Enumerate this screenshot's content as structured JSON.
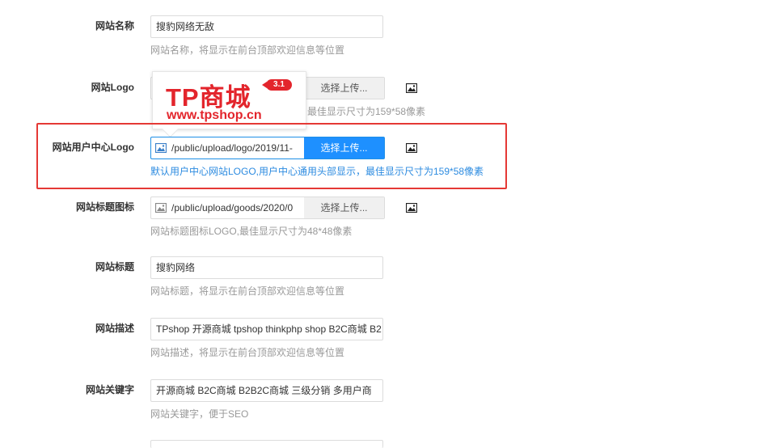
{
  "fields": {
    "site_name": {
      "label": "网站名称",
      "value": "搜豹网络无敌",
      "hint": "网站名称，将显示在前台顶部欢迎信息等位置"
    },
    "site_logo": {
      "label": "网站Logo",
      "button": "选择上传...",
      "hint_visible": "最佳显示尺寸为159*58像素"
    },
    "user_center_logo": {
      "label": "网站用户中心Logo",
      "path": "/public/upload/logo/2019/11-",
      "button": "选择上传...",
      "hint": "默认用户中心网站LOGO,用户中心通用头部显示，最佳显示尺寸为159*58像素"
    },
    "site_icon": {
      "label": "网站标题图标",
      "path": "/public/upload/goods/2020/0",
      "button": "选择上传...",
      "hint": "网站标题图标LOGO,最佳显示尺寸为48*48像素"
    },
    "site_title": {
      "label": "网站标题",
      "value": "搜豹网络",
      "hint": "网站标题，将显示在前台顶部欢迎信息等位置"
    },
    "site_desc": {
      "label": "网站描述",
      "value": "TPshop 开源商城 tpshop thinkphp shop B2C商城 B2",
      "hint": "网站描述，将显示在前台顶部欢迎信息等位置"
    },
    "site_keywords": {
      "label": "网站关键字",
      "value": "开源商城 B2C商城  B2B2C商城  三级分销  多用户商",
      "hint": "网站关键字，便于SEO"
    }
  },
  "logo_popup": {
    "brand": "TP商城",
    "version": "3.1",
    "url": "www.tpshop.cn"
  },
  "colors": {
    "accent": "#1e90ff",
    "highlight": "#e53935",
    "brand": "#e3252c",
    "hint": "#999999"
  },
  "icons": {
    "image_icon": "image-icon"
  }
}
